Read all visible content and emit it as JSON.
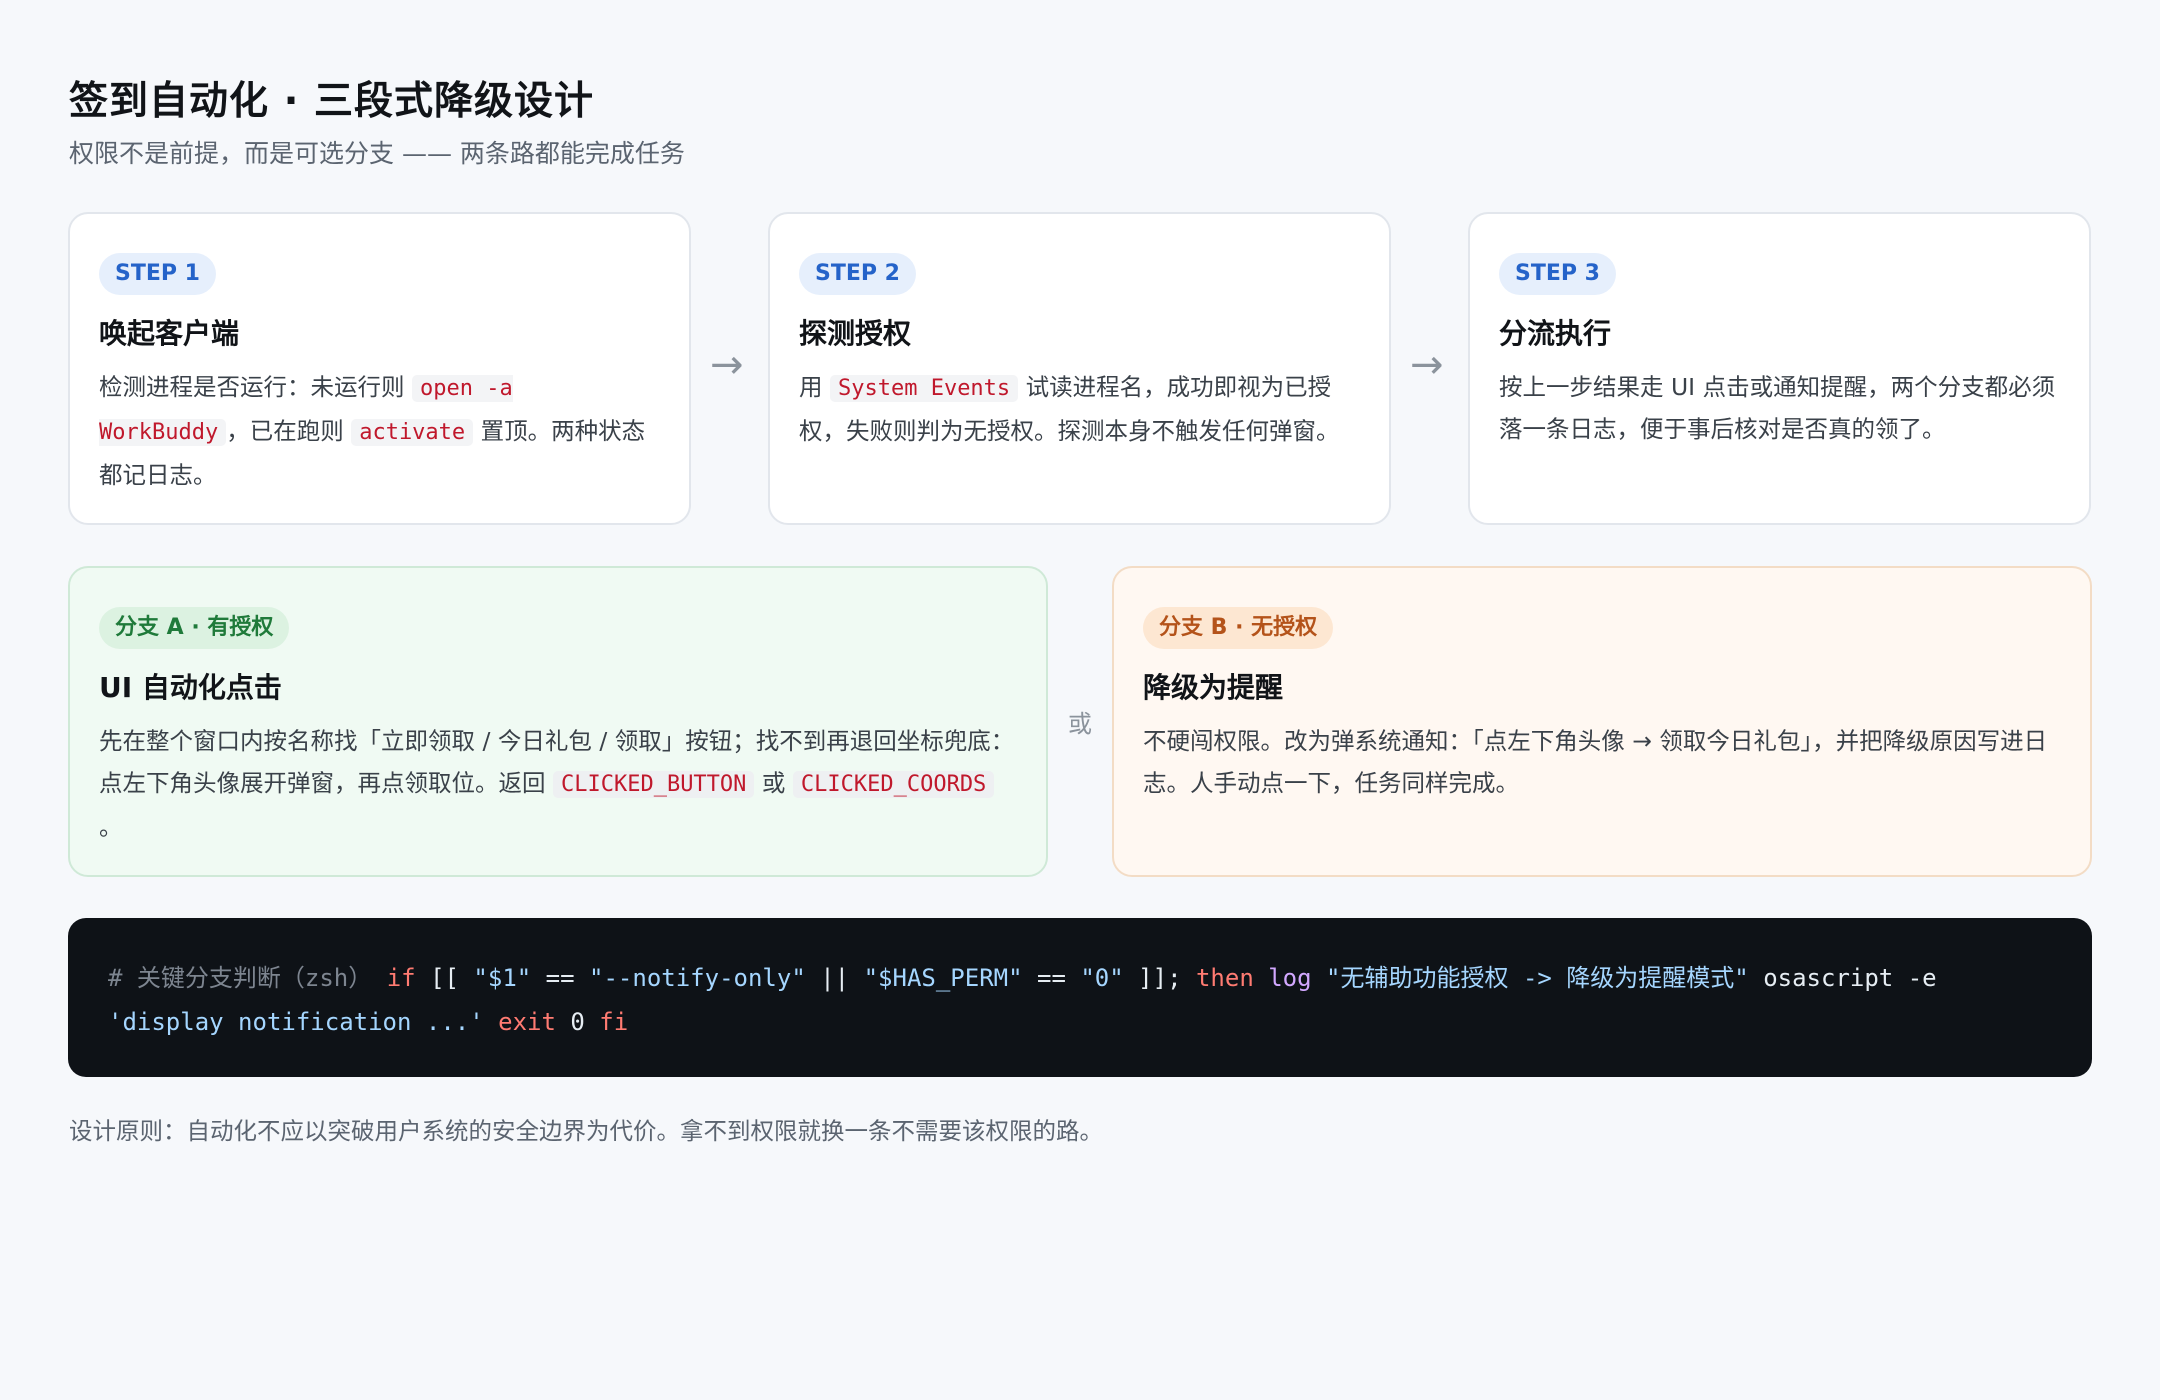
{
  "header": {
    "title": "签到自动化 · 三段式降级设计",
    "subtitle": "权限不是前提，而是可选分支 —— 两条路都能完成任务"
  },
  "steps": [
    {
      "badge": "STEP 1",
      "title": "唤起客户端",
      "body": [
        "检测进程是否运行：未运行则 ",
        "open -a WorkBuddy",
        "，已在跑则 ",
        "activate",
        " 置顶。两种状态都记日志。"
      ]
    },
    {
      "badge": "STEP 2",
      "title": "探测授权",
      "body": [
        "用 ",
        "System Events",
        " 试读进程名，成功即视为已授权，失败则判为无授权。探测本身不触发任何弹窗。"
      ]
    },
    {
      "badge": "STEP 3",
      "title": "分流执行",
      "body": [
        "按上一步结果走 UI 点击或通知提醒，两个分支都必须落一条日志，便于事后核对是否真的领了。"
      ]
    }
  ],
  "arrows": [
    "→",
    "→"
  ],
  "branches": {
    "a": {
      "badge": "分支 A · 有授权",
      "title": "UI 自动化点击",
      "body": [
        "先在整个窗口内按名称找「立即领取 / 今日礼包 / 领取」按钮；找不到再退回坐标兜底：点左下角头像展开弹窗，再点领取位。返回 ",
        "CLICKED_BUTTON",
        " 或 ",
        "CLICKED_COORDS",
        " 。"
      ]
    },
    "or_label": "或",
    "b": {
      "badge": "分支 B · 无授权",
      "title": "降级为提醒",
      "body": [
        "不硬闯权限。改为弹系统通知：「点左下角头像 → 领取今日礼包」，并把降级原因写进日志。人手动点一下，任务同样完成。"
      ]
    }
  },
  "code": {
    "comment": "# 关键分支判断（zsh）",
    "kw_if": "if",
    "open_bracket": "[[",
    "arg1": "\"$1\"",
    "op_eq1": "==",
    "notify_only": "\"--notify-only\"",
    "op_or": "||",
    "has_perm": "\"$HAS_PERM\"",
    "op_eq2": "==",
    "zero_str": "\"0\"",
    "close_bracket": "]];",
    "kw_then": "then",
    "fn_log": "log",
    "log_msg": "\"无辅助功能授权 -> 降级为提醒模式\"",
    "cmd_osascript": "osascript -e",
    "osa_arg": "'display notification ...'",
    "kw_exit": "exit",
    "exit_code": "0",
    "kw_fi": "fi"
  },
  "footer": "设计原则：自动化不应以突破用户系统的安全边界为代价。拿不到权限就换一条不需要该权限的路。",
  "colors": {
    "background": "#f6f8fb",
    "step_badge": "#2563c9",
    "branch_a": "#1f7a3a",
    "branch_b": "#b4531a",
    "code_bg": "#0e1217",
    "inline_code": "#c0182c"
  }
}
